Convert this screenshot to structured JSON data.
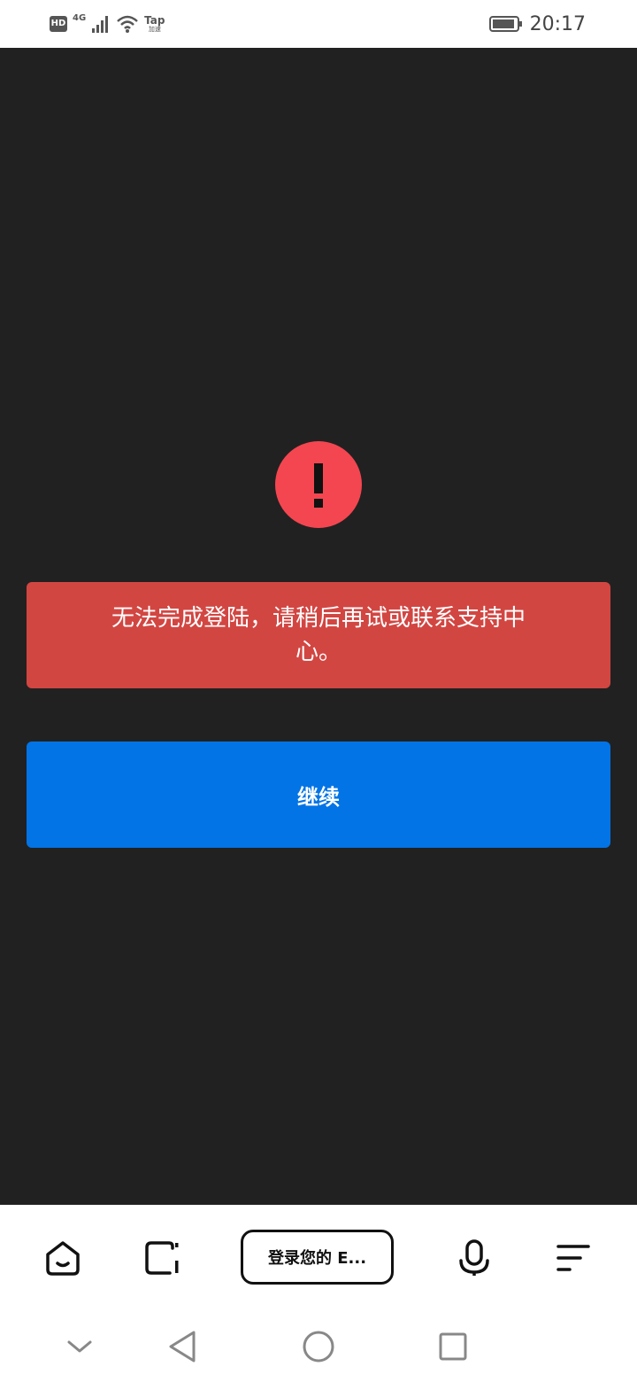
{
  "status_bar": {
    "hd_label": "HD",
    "network_label": "4G",
    "tap_label": "Tap",
    "tap_sub": "加速",
    "time": "20:17"
  },
  "error": {
    "message": "无法完成登陆，请稍后再试或联系支持中心。"
  },
  "continue_button": {
    "label": "继续"
  },
  "toolbar": {
    "url_text": "登录您的 E..."
  },
  "icons": {
    "alert": "exclamation-icon",
    "home": "home-icon",
    "tabs": "tabs-icon",
    "mic": "microphone-icon",
    "menu": "menu-icon",
    "collapse": "chevron-down-icon",
    "back": "back-triangle-icon",
    "home_nav": "home-circle-icon",
    "recents": "recents-square-icon"
  },
  "colors": {
    "background": "#212121",
    "alert": "#f44650",
    "error_box": "#d24642",
    "primary": "#0274e6"
  }
}
